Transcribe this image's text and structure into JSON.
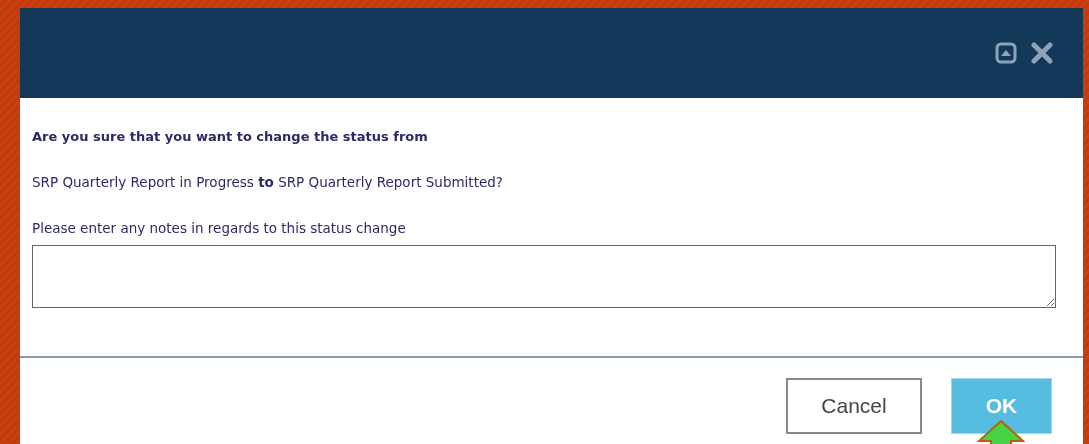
{
  "dialog": {
    "header_buttons": [
      {
        "kind": "restore"
      },
      {
        "kind": "close"
      }
    ],
    "question": "Are you sure that you want to change the status from",
    "transition": "SRP Quarterly Report in Progress **to** SRP Quarterly Report Submitted?",
    "notes_label": "Please enter any notes in regards to this status change",
    "buttons": [
      {
        "label": "Cancel",
        "kind": "secondary"
      },
      {
        "label": "OK",
        "kind": "primary"
      }
    ],
    "pointer_arrow": {
      "kind": "up"
    }
  }
}
